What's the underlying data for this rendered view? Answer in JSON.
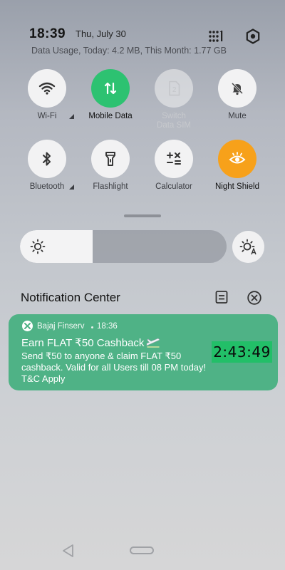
{
  "status": {
    "time": "18:39",
    "date": "Thu, July 30",
    "usage": "Data Usage, Today: 4.2 MB, This Month: 1.77 GB"
  },
  "icons": {
    "grid": "grid-icon",
    "settings": "gear-icon"
  },
  "tiles": [
    {
      "label": "Wi-Fi",
      "icon": "wifi-icon",
      "state": "off"
    },
    {
      "label": "Mobile Data",
      "icon": "mobile-data-icon",
      "state": "on",
      "accent": "#2dc271"
    },
    {
      "label": "Switch Data SIM",
      "icon": "sim-2-icon",
      "state": "disabled",
      "sim_number": "2"
    },
    {
      "label": "Mute",
      "icon": "bell-off-icon",
      "state": "off"
    },
    {
      "label": "Bluetooth",
      "icon": "bluetooth-icon",
      "state": "off"
    },
    {
      "label": "Flashlight",
      "icon": "flashlight-icon",
      "state": "off"
    },
    {
      "label": "Calculator",
      "icon": "calculator-icon",
      "state": "off"
    },
    {
      "label": "Night Shield",
      "icon": "eye-icon",
      "state": "on",
      "accent": "#f7a11a"
    }
  ],
  "brightness": {
    "level_percent": 35
  },
  "notification_center": {
    "title": "Notification Center"
  },
  "notification": {
    "app": "Bajaj Finserv",
    "time": "18:36",
    "title": "Earn FLAT ₹50 Cashback",
    "body": "Send ₹50 to anyone & claim FLAT ₹50 cashback. Valid for all Users till 08 PM today! T&C Apply",
    "timer": "2:43:49",
    "card_color": "#4fb286",
    "timer_color": "#22bf68"
  }
}
